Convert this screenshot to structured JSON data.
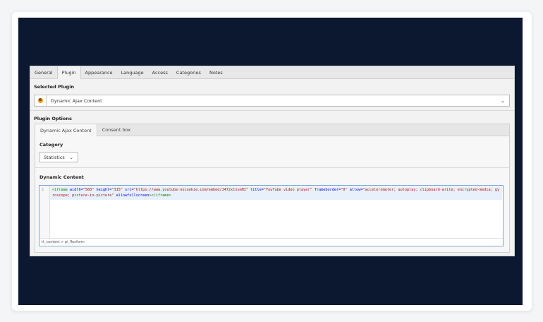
{
  "tabs": [
    "General",
    "Plugin",
    "Appearance",
    "Language",
    "Access",
    "Categories",
    "Notes"
  ],
  "active_tab": "Plugin",
  "selected_plugin": {
    "title": "Selected Plugin",
    "value": "Dynamic Ajax Content",
    "icon": "plugin-icon"
  },
  "plugin_options": {
    "title": "Plugin Options",
    "tabs": [
      "Dynamic Ajax Content",
      "Consent box"
    ],
    "category_title": "Category",
    "category_value": "Statistics",
    "dynamic_content_title": "Dynamic Content",
    "line_number": "1",
    "code": {
      "open_tag": "<iframe",
      "parts": [
        {
          "attr": " width=",
          "val": "\"560\""
        },
        {
          "attr": " height=",
          "val": "\"315\""
        },
        {
          "attr": " src=",
          "val": "\"https://www.youtube-nocookie.com/embed/J472xtnsmHI\""
        },
        {
          "attr": " title=",
          "val": "\"YouTube video player\""
        },
        {
          "attr": " frameborder=",
          "val": "\"0\""
        },
        {
          "attr": " allow=",
          "val": "\"accelerometer; autoplay; clipboard-write; encrypted-media; gyroscope; picture-in-picture\""
        },
        {
          "attr": " allowfullscreen",
          "val": ""
        }
      ],
      "close": "></iframe>"
    },
    "status_path": "tt_content > pi_flexform"
  },
  "colors": {
    "background_dark": "#0c1730",
    "tag": "#117700",
    "attribute": "#0000cc",
    "string": "#aa1111"
  }
}
